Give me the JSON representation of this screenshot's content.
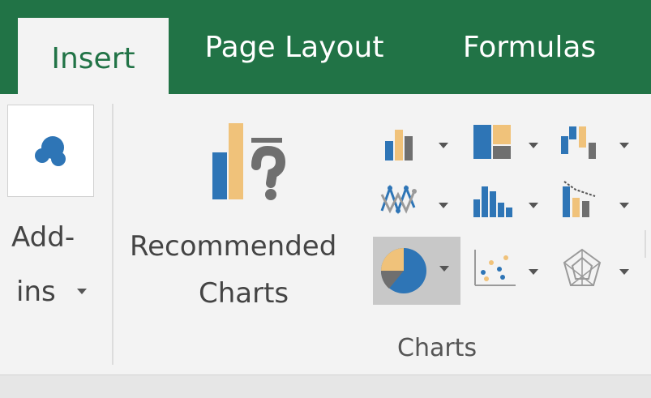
{
  "tabs": [
    {
      "label": "Insert",
      "active": true
    },
    {
      "label": "Page Layout",
      "active": false
    },
    {
      "label": "Formulas",
      "active": false
    }
  ],
  "addins": {
    "label_line1": "Add-",
    "label_line2": "ins",
    "icon": "addins-icon"
  },
  "recommended": {
    "label_line1": "Recommended",
    "label_line2": "Charts",
    "icon": "recommended-charts-icon"
  },
  "charts_group": {
    "label": "Charts",
    "buttons": [
      {
        "name": "column-chart-icon"
      },
      {
        "name": "hierarchy-chart-icon"
      },
      {
        "name": "waterfall-chart-icon"
      },
      {
        "name": "line-chart-icon"
      },
      {
        "name": "statistic-chart-icon"
      },
      {
        "name": "combo-chart-icon"
      },
      {
        "name": "pie-chart-icon",
        "selected": true
      },
      {
        "name": "scatter-chart-icon"
      },
      {
        "name": "radar-chart-icon"
      }
    ]
  },
  "colors": {
    "excel_green": "#217346",
    "blue": "#2e75b6",
    "gold": "#f0c27a",
    "gray": "#6f6f6f"
  }
}
